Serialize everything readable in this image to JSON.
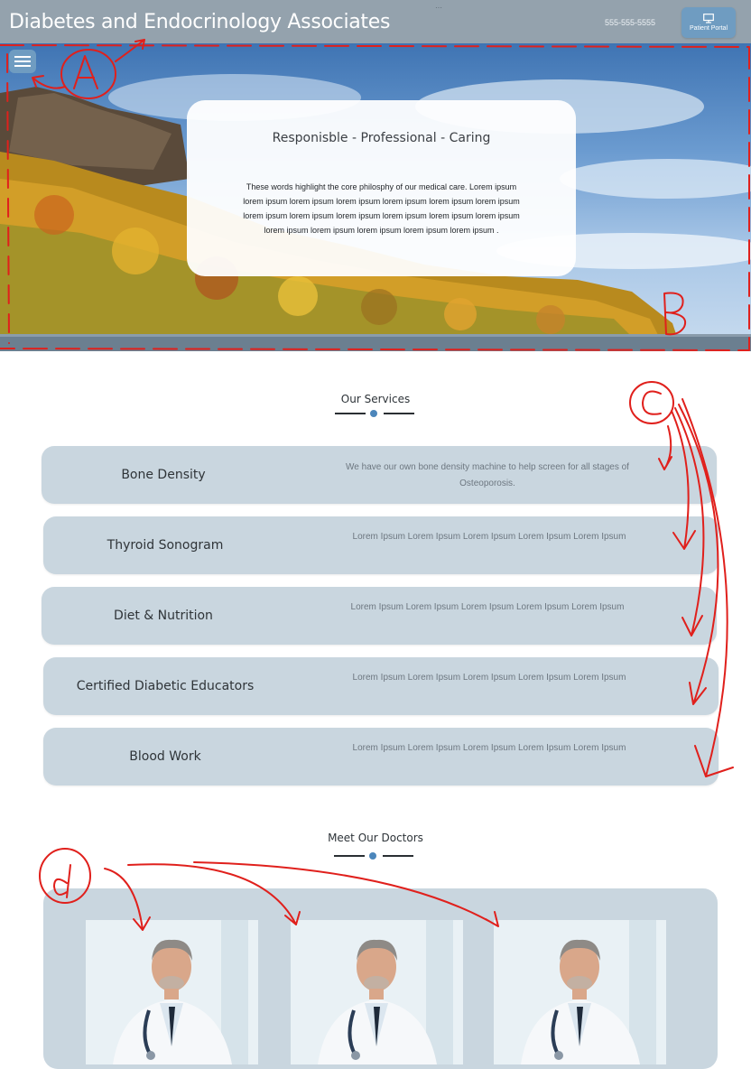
{
  "header": {
    "title": "Diabetes and Endocrinology Associates",
    "phone": "555-555-5555",
    "portal_label": "Patient Portal",
    "portal_icon": "monitor-icon",
    "menu_icon": "hamburger-icon"
  },
  "hero": {
    "heading": "Responisble - Professional - Caring",
    "body": "These words highlight the core philosphy of our medical care.  Lorem ipsum lorem ipsum lorem ipsum lorem ipsum lorem ipsum lorem ipsum lorem ipsum lorem ipsum lorem ipsum lorem ipsum lorem ipsum lorem ipsum lorem ipsum lorem ipsum lorem ipsum lorem ipsum lorem ipsum lorem ipsum ."
  },
  "services": {
    "title": "Our Services",
    "items": [
      {
        "name": "Bone Density",
        "desc": "We have our own bone density machine to help screen for all stages of Osteoporosis."
      },
      {
        "name": "Thyroid Sonogram",
        "desc": "Lorem Ipsum Lorem Ipsum Lorem Ipsum Lorem Ipsum Lorem Ipsum"
      },
      {
        "name": "Diet & Nutrition",
        "desc": "Lorem Ipsum Lorem Ipsum Lorem Ipsum Lorem Ipsum Lorem Ipsum"
      },
      {
        "name": "Certified Diabetic Educators",
        "desc": "Lorem Ipsum Lorem Ipsum Lorem Ipsum Lorem Ipsum Lorem Ipsum"
      },
      {
        "name": "Blood Work",
        "desc": "Lorem Ipsum Lorem Ipsum Lorem Ipsum Lorem Ipsum Lorem Ipsum"
      }
    ]
  },
  "doctors": {
    "title": "Meet Our Doctors"
  },
  "annotations": {
    "labels": [
      "A",
      "B",
      "C",
      "d"
    ]
  },
  "colors": {
    "header_bg": "#94a2ad",
    "accent": "#6f9cc1",
    "card_bg": "#c9d6df",
    "annotation": "#e0201c"
  }
}
